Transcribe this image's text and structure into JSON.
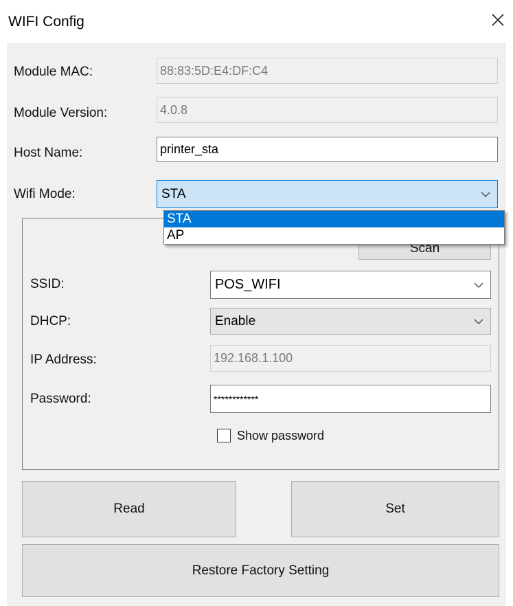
{
  "window": {
    "title": "WIFI Config",
    "close_icon": "close-icon"
  },
  "fields": {
    "module_mac_label": "Module MAC:",
    "module_mac_value": "88:83:5D:E4:DF:C4",
    "module_version_label": "Module Version:",
    "module_version_value": "4.0.8",
    "host_name_label": "Host Name:",
    "host_name_value": "printer_sta",
    "wifi_mode_label": "Wifi Mode:",
    "wifi_mode_value": "STA",
    "wifi_mode_options": [
      "STA",
      "AP"
    ],
    "scan_label": "Scan",
    "ssid_label": "SSID:",
    "ssid_value": "POS_WIFI",
    "dhcp_label": "DHCP:",
    "dhcp_value": "Enable",
    "ip_label": "IP Address:",
    "ip_value": "192.168.1.100",
    "password_label": "Password:",
    "password_value": "************",
    "show_password_label": "Show password"
  },
  "buttons": {
    "read": "Read",
    "set": "Set",
    "restore": "Restore Factory Setting"
  },
  "colors": {
    "accent": "#0078d7",
    "combo_open_bg": "#cce4f7",
    "dialog_bg": "#f0f0f0",
    "button_bg": "#e1e1e1"
  }
}
